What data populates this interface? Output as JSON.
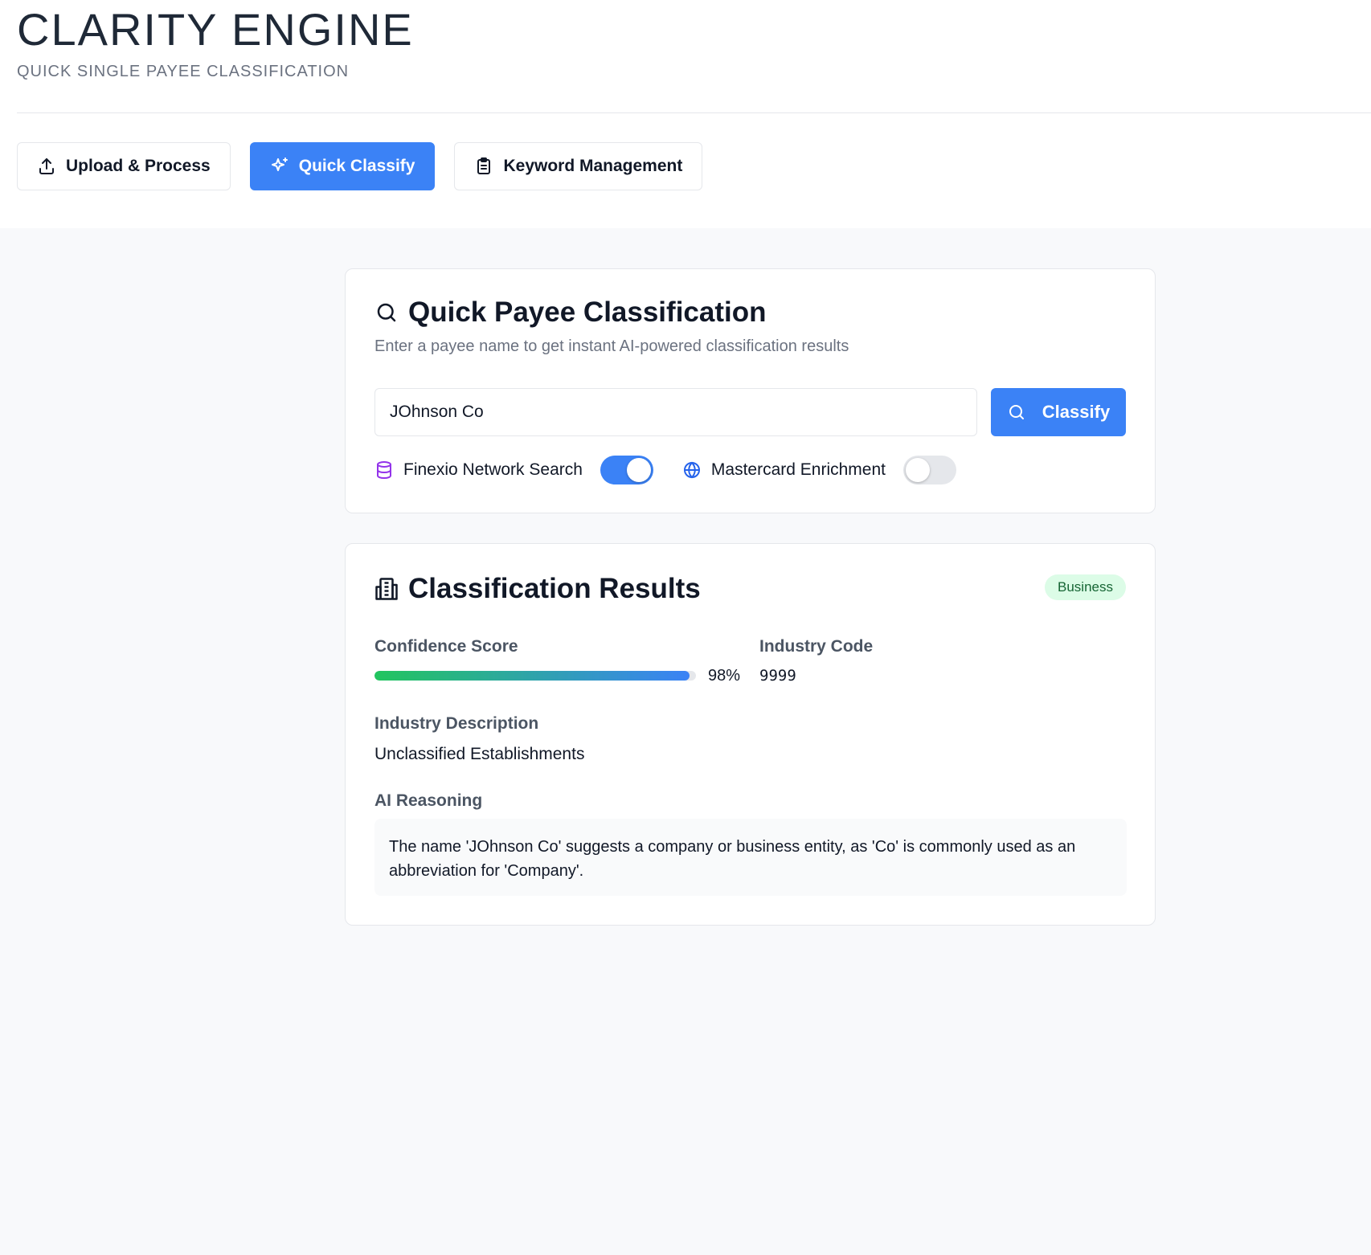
{
  "app": {
    "title": "CLARITY ENGINE",
    "subtitle": "QUICK SINGLE PAYEE CLASSIFICATION"
  },
  "nav": {
    "items": [
      {
        "label": "Upload & Process",
        "icon": "upload-icon",
        "active": false
      },
      {
        "label": "Quick Classify",
        "icon": "sparkles-icon",
        "active": true
      },
      {
        "label": "Keyword Management",
        "icon": "clipboard-icon",
        "active": false
      }
    ]
  },
  "search_card": {
    "title": "Quick Payee Classification",
    "description": "Enter a payee name to get instant AI-powered classification results",
    "input_value": "JOhnson Co",
    "classify_label": "Classify",
    "toggles": [
      {
        "label": "Finexio Network Search",
        "icon": "database-icon",
        "on": true
      },
      {
        "label": "Mastercard Enrichment",
        "icon": "globe-icon",
        "on": false
      }
    ]
  },
  "results": {
    "title": "Classification Results",
    "badge": "Business",
    "confidence_label": "Confidence Score",
    "confidence_value": "98%",
    "confidence_fraction": 0.98,
    "industry_code_label": "Industry Code",
    "industry_code": "9999",
    "industry_desc_label": "Industry Description",
    "industry_desc": "Unclassified Establishments",
    "reasoning_label": "AI Reasoning",
    "reasoning": "The name 'JOhnson Co' suggests a company or business entity, as 'Co' is commonly used as an abbreviation for 'Company'."
  },
  "colors": {
    "accent": "#3b82f6",
    "badge_bg": "#dcfce7",
    "badge_text": "#166534",
    "database_icon": "#9333ea",
    "globe_icon": "#2563eb"
  }
}
